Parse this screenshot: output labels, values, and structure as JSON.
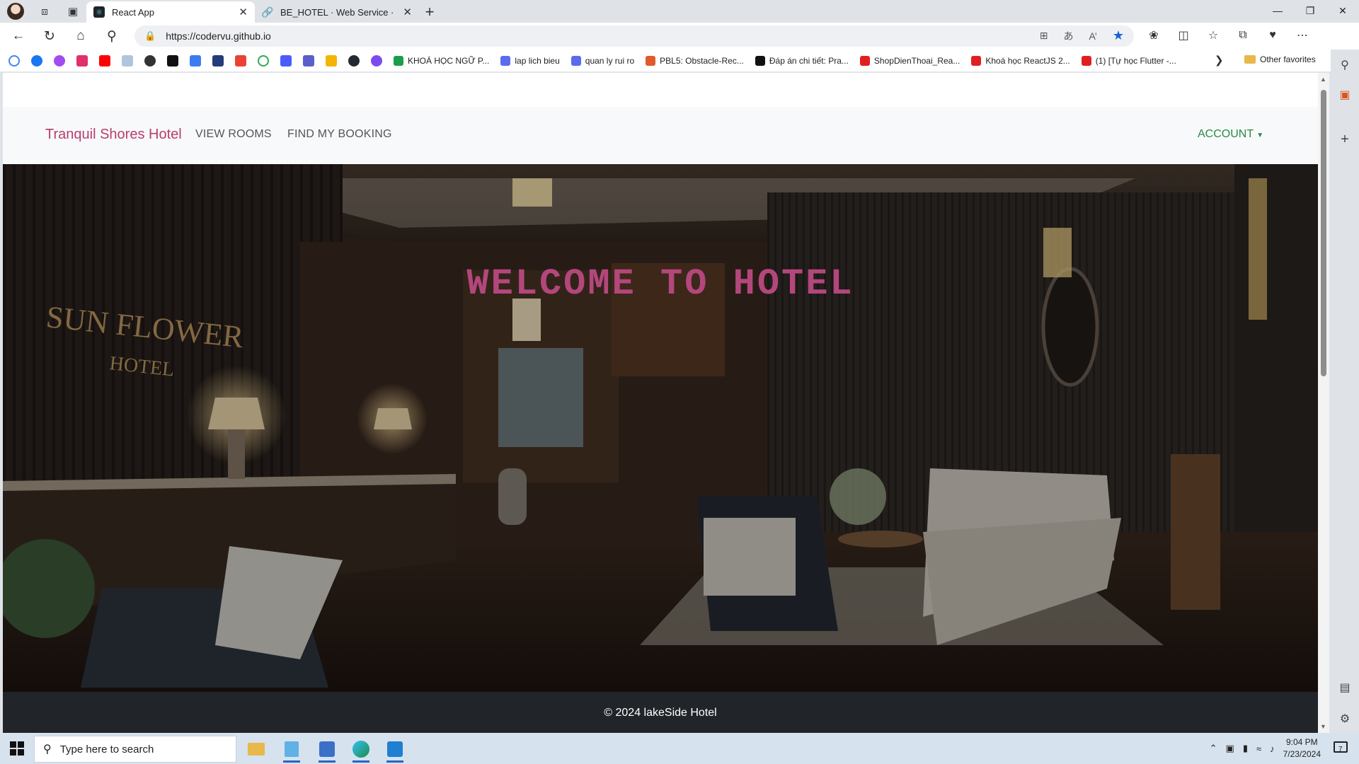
{
  "browser": {
    "tabs": [
      {
        "title": "React App",
        "active": true
      },
      {
        "title": "BE_HOTEL · Web Service · Rende",
        "active": false
      }
    ],
    "url": "https://codervu.github.io",
    "favorites": [
      {
        "label": "KHOÁ HỌC NGỮ P...",
        "color": "#1b9e4b"
      },
      {
        "label": "lap lich bieu",
        "color": "#5b6bf0"
      },
      {
        "label": "quan ly rui ro",
        "color": "#5b6bf0"
      },
      {
        "label": "PBL5: Obstacle-Rec...",
        "color": "#e05a2b"
      },
      {
        "label": "Đáp án chi tiết: Pra...",
        "color": "#111111"
      },
      {
        "label": "ShopDienThoai_Rea...",
        "color": "#e02020"
      },
      {
        "label": "Khoá học ReactJS 2...",
        "color": "#e02020"
      },
      {
        "label": "(1) [Tự học Flutter -...",
        "color": "#e02020"
      }
    ],
    "other_favorites": "Other favorites"
  },
  "site": {
    "brand": "Tranquil Shores Hotel",
    "nav": {
      "view_rooms": "VIEW ROOMS",
      "find_booking": "FIND MY BOOKING",
      "account": "ACCOUNT"
    },
    "hero_title": "WELCOME TO HOTEL",
    "hero_sign_line1": "SUN FLOWER",
    "hero_sign_line2": "HOTEL",
    "footer": "© 2024 lakeSide Hotel"
  },
  "taskbar": {
    "search_placeholder": "Type here to search",
    "time": "9:04 PM",
    "date": "7/23/2024",
    "notifications": "7"
  },
  "colors": {
    "brand": "#b83d6f",
    "hero_title": "#b3477c",
    "account": "#2a8a4a",
    "footer_bg": "#212529"
  }
}
